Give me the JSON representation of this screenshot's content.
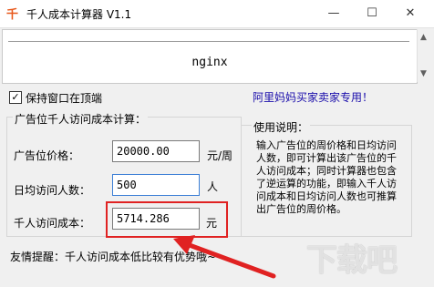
{
  "window": {
    "title": "千人成本计算器 V1.1",
    "icon": "app-logo-icon",
    "minimize": "—",
    "maximize": "☐",
    "close": "✕"
  },
  "ad": {
    "text": "nginx"
  },
  "keep_on_top": {
    "label": "保持窗口在顶端",
    "checked": true
  },
  "promo_link": "阿里妈妈买家卖家专用！",
  "calc_group": {
    "title": "广告位千人访问成本计算：",
    "rows": [
      {
        "label": "广告位价格：",
        "value": "20000.00",
        "unit": "元/周"
      },
      {
        "label": "日均访问人数：",
        "value": "500",
        "unit": "人"
      },
      {
        "label": "千人访问成本：",
        "value": "5714.286",
        "unit": "元"
      }
    ]
  },
  "help": {
    "title": "使用说明：",
    "text": "输入广告位的周价格和日均访问人数，即可计算出该广告位的千人访问成本；同时计算器也包含了逆运算的功能，即输入千人访问成本和日均访问人数也可推算出广告位的周价格。"
  },
  "tip": "友情提醒：千人访问成本低比较有优势哦~",
  "colors": {
    "highlight": "#e02222",
    "link": "#1a0dab"
  }
}
